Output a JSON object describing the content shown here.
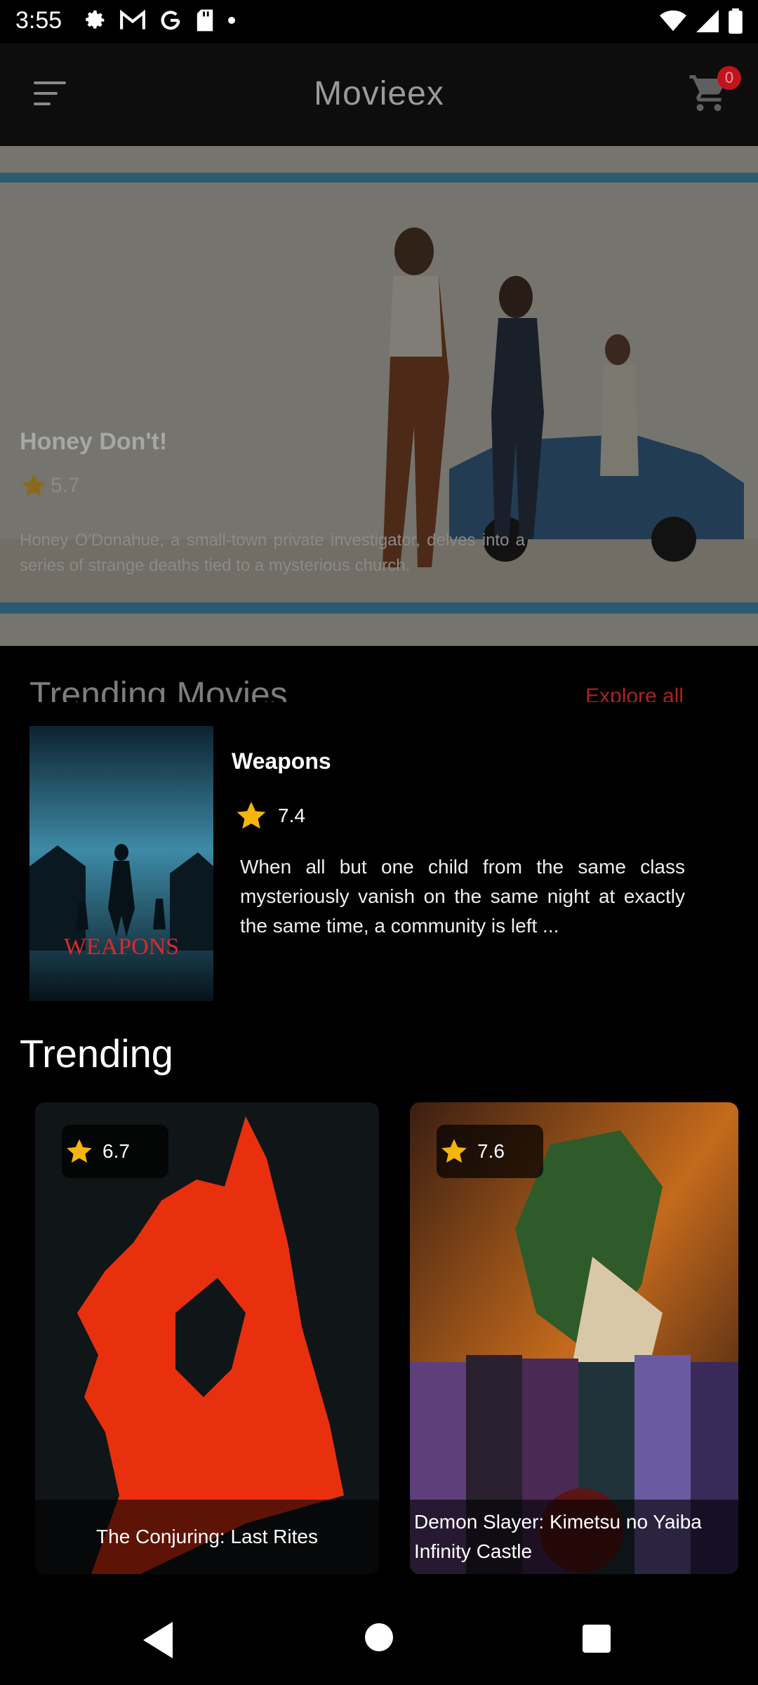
{
  "status_bar": {
    "time": "3:55"
  },
  "app_bar": {
    "title": "Movieex",
    "cart_count": "0"
  },
  "hero": {
    "title": "Honey Don't!",
    "rating": "5.7",
    "description": "Honey O'Donahue, a small-town private investigator, delves into a series of strange deaths tied to a mysterious church."
  },
  "trending_movies_section": {
    "title": "Trending Movies",
    "explore_label": "Explore all"
  },
  "featured": {
    "title": "Weapons",
    "rating": "7.4",
    "description": "When all but one child from the same class mysteriously vanish on the same night at exactly the same time, a community is left ...",
    "poster_text": "WEAPONS"
  },
  "trending": {
    "title": "Trending",
    "items": [
      {
        "title": "The Conjuring: Last Rites",
        "rating": "6.7"
      },
      {
        "title": "Demon Slayer: Kimetsu no Yaiba Infinity Castle",
        "rating": "7.6"
      }
    ]
  },
  "colors": {
    "accent_star": "#f5b50a",
    "badge": "#c0141d",
    "explore": "#aa2222"
  }
}
